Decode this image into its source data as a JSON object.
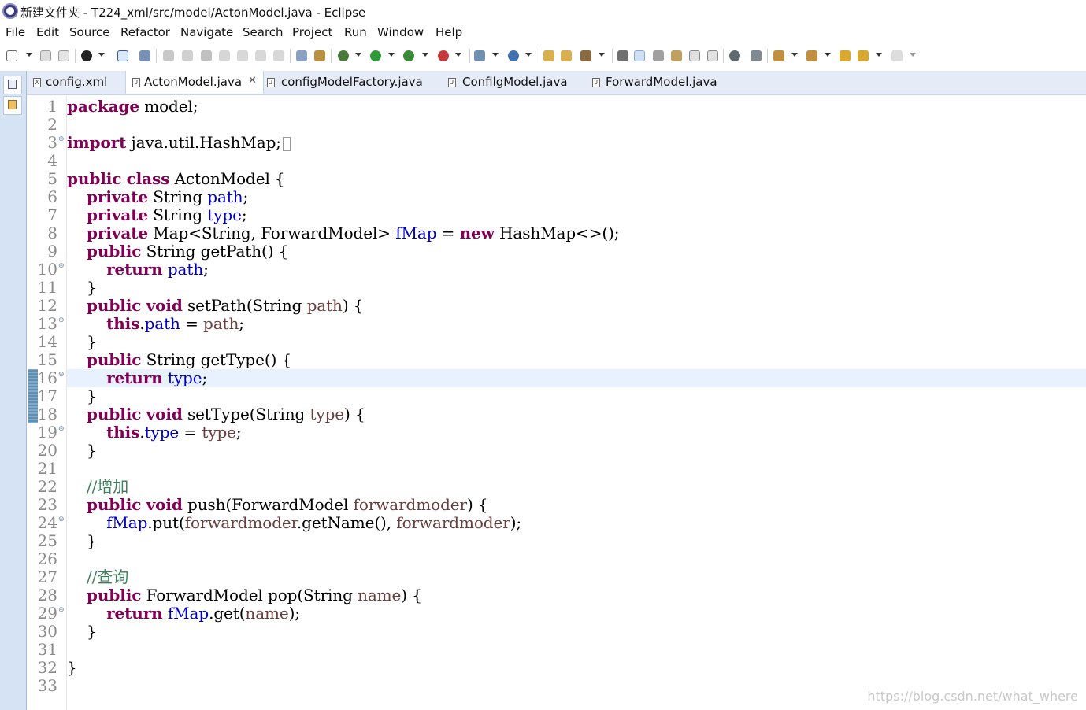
{
  "window": {
    "title": "新建文件夹 - T224_xml/src/model/ActonModel.java - Eclipse"
  },
  "menu": [
    "File",
    "Edit",
    "Source",
    "Refactor",
    "Navigate",
    "Search",
    "Project",
    "Run",
    "Window",
    "Help"
  ],
  "tabs": [
    {
      "label": "config.xml",
      "icon": "xml-file-icon"
    },
    {
      "label": "ActonModel.java",
      "icon": "java-file-icon",
      "active": true,
      "close": "✕"
    },
    {
      "label": "configModelFactory.java",
      "icon": "java-file-icon"
    },
    {
      "label": "ConfilgModel.java",
      "icon": "java-file-icon"
    },
    {
      "label": "ForwardModel.java",
      "icon": "java-file-icon"
    }
  ],
  "editor": {
    "current_line": 16,
    "fold_markers": [
      3,
      10,
      13,
      16,
      19,
      24,
      29
    ],
    "changed_lines": [
      16,
      17,
      18
    ],
    "lines": [
      "package model;",
      "",
      "import java.util.HashMap;",
      "",
      "public class ActonModel {",
      "    private String path;",
      "    private String type;",
      "    private Map<String, ForwardModel> fMap = new HashMap<>();",
      "    public String getPath() {",
      "        return path;",
      "    }",
      "    public void setPath(String path) {",
      "        this.path = path;",
      "    }",
      "    public String getType() {",
      "        return type;",
      "    }",
      "    public void setType(String type) {",
      "        this.type = type;",
      "    }",
      "",
      "    //增加",
      "    public void push(ForwardModel forwardmoder) {",
      "        fMap.put(forwardmoder.getName(), forwardmoder);",
      "    }",
      "",
      "    //查询",
      "    public ForwardModel pop(String name) {",
      "        return fMap.get(name);",
      "    }",
      "",
      "}",
      ""
    ]
  },
  "watermark": "https://blog.csdn.net/what_where"
}
